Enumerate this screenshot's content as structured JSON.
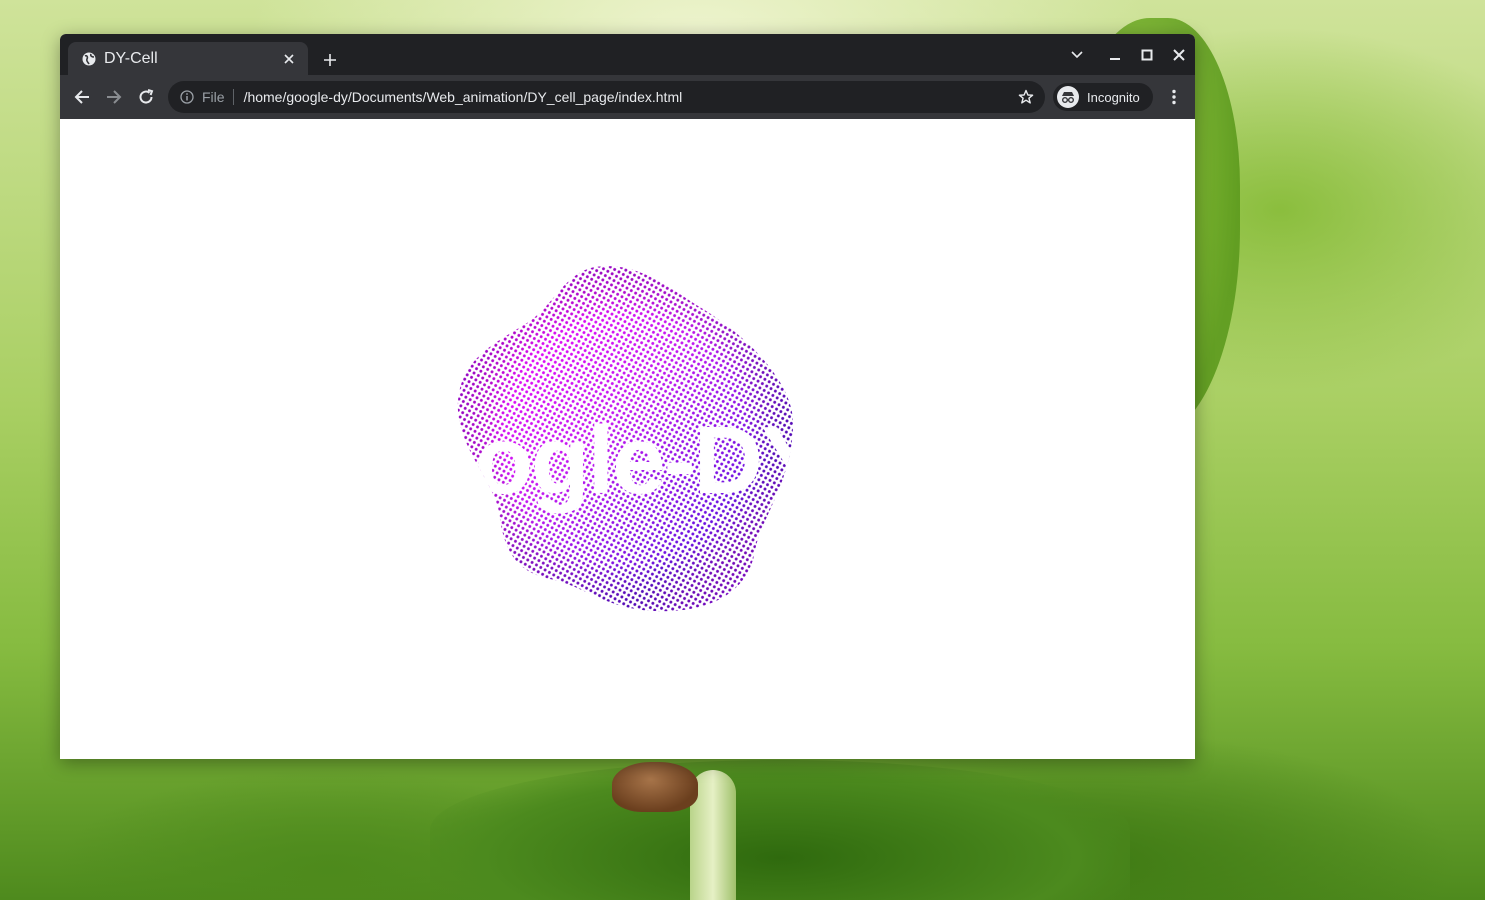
{
  "window": {
    "tab_title": "DY-Cell",
    "address_scheme": "File",
    "address_url": "/home/google-dy/Documents/Web_animation/DY_cell_page/index.html",
    "profile_label": "Incognito"
  },
  "page": {
    "overlay_text": "Google-DY"
  },
  "colors": {
    "blob_magenta": "#ff00ff",
    "blob_violet": "#5a10e0",
    "chrome_dark": "#202124",
    "chrome_toolbar": "#35363a"
  }
}
